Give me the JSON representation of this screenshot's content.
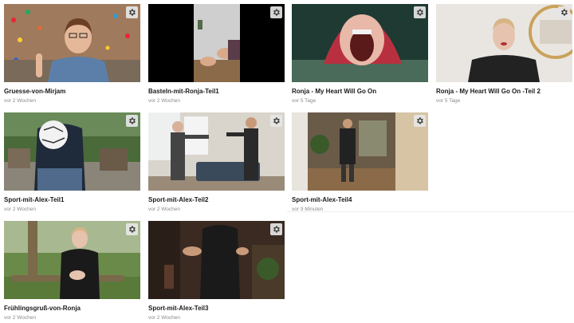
{
  "icons": {
    "settings": "gear-icon"
  },
  "videos": [
    {
      "title": "Gruesse-von-Mirjam",
      "age": "vor 2 Wochen"
    },
    {
      "title": "Basteln-mit-Ronja-Teil1",
      "age": "vor 2 Wochen"
    },
    {
      "title": "Ronja - My Heart Will Go On",
      "age": "vor 5 Tage"
    },
    {
      "title": "Ronja - My Heart Will Go On -Teil 2",
      "age": "vor 5 Tage"
    },
    {
      "title": "Sport-mit-Alex-Teil1",
      "age": "vor 2 Wochen"
    },
    {
      "title": "Sport-mit-Alex-Teil2",
      "age": "vor 2 Wochen"
    },
    {
      "title": "Sport-mit-Alex-Teil4",
      "age": "vor 9 Minuten"
    },
    {
      "title": "Frühlingsgruß-von-Ronja",
      "age": "vor 2 Wochen"
    },
    {
      "title": "Sport-mit-Alex-Teil3",
      "age": "vor 2 Wochen"
    }
  ]
}
